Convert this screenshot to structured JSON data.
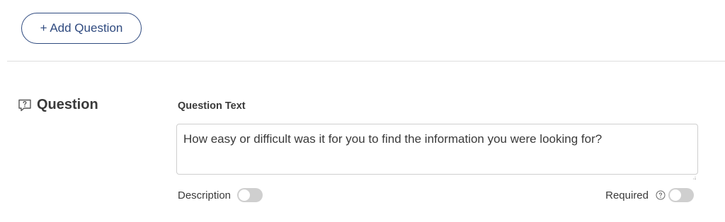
{
  "toolbar": {
    "add_question_label": "+ Add Question"
  },
  "question": {
    "section_title": "Question",
    "section_icon": "question-bubble-icon",
    "field_label": "Question Text",
    "text_value": "How easy or difficult was it for you to find the information you were looking for?",
    "description_label": "Description",
    "description_enabled": false,
    "required_label": "Required",
    "required_enabled": false,
    "help_icon": "help-circle-icon"
  },
  "colors": {
    "accent": "#2f4a7f",
    "toggle_off": "#cfcfcf",
    "divider": "#dedede",
    "text": "#3a3a3a"
  }
}
